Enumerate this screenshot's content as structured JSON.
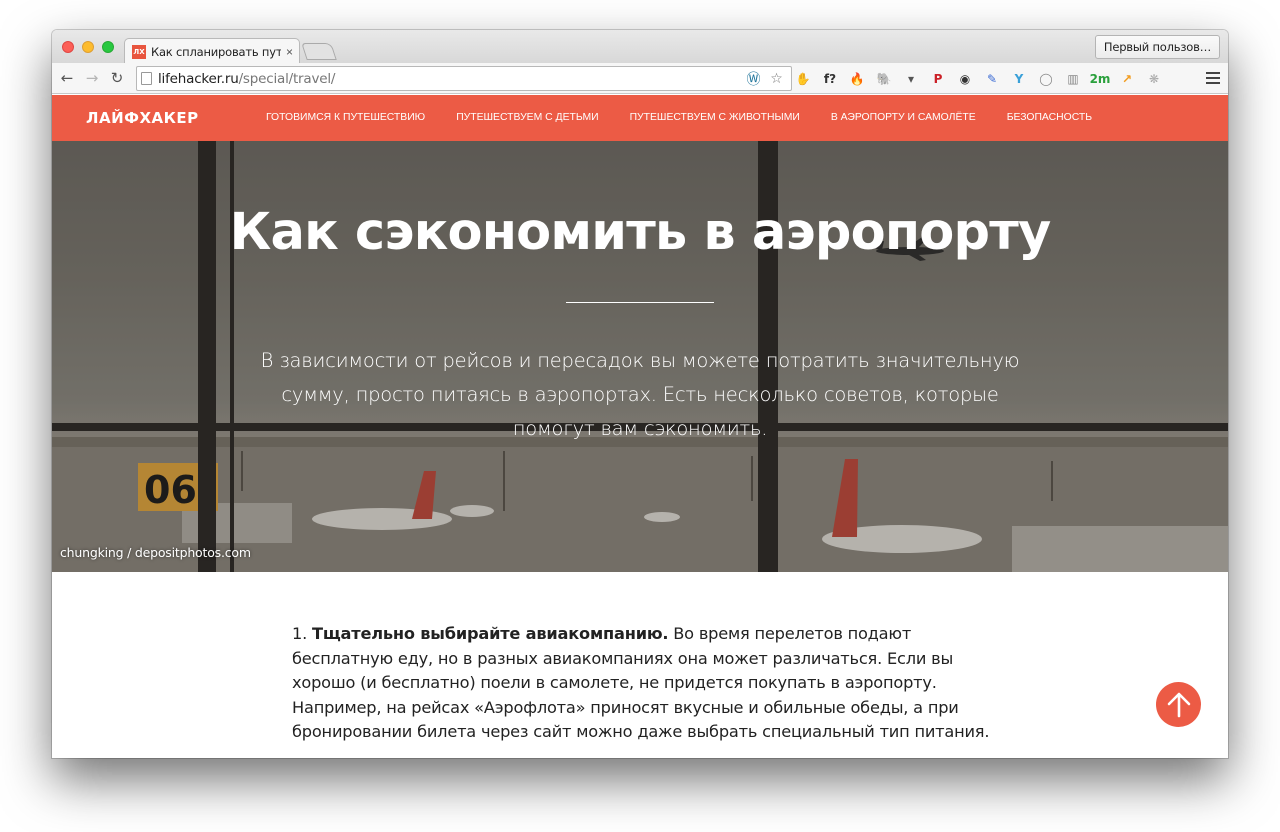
{
  "browser": {
    "tab": {
      "favicon_text": "ЛХ",
      "title": "Как спланировать путеше",
      "close": "×"
    },
    "profile_label": "Первый пользов…",
    "nav": {
      "back": "←",
      "forward": "→",
      "reload": "↻"
    },
    "url": {
      "host": "lifehacker.ru",
      "path": "/special/travel/"
    },
    "omnibox_icons": [
      "wordpress-icon",
      "star-icon"
    ],
    "extensions": [
      {
        "name": "adblock-icon",
        "glyph": "✋",
        "color": "#d22d2d"
      },
      {
        "name": "font-icon",
        "glyph": "f?",
        "color": "#ffffff"
      },
      {
        "name": "fire-icon",
        "glyph": "🔥",
        "color": "#ffffff"
      },
      {
        "name": "evernote-icon",
        "glyph": "🐘",
        "color": "#ffffff"
      },
      {
        "name": "pocket-icon",
        "glyph": "▾",
        "color": "#555555"
      },
      {
        "name": "pinterest-icon",
        "glyph": "P",
        "color": "#cb2027"
      },
      {
        "name": "camera-icon",
        "glyph": "◉",
        "color": "#333333"
      },
      {
        "name": "eyedropper-icon",
        "glyph": "✎",
        "color": "#3a6ad4"
      },
      {
        "name": "y-icon",
        "glyph": "Y",
        "color": "#3aa0d8"
      },
      {
        "name": "circle-icon",
        "glyph": "◯",
        "color": "#888888"
      },
      {
        "name": "reader-icon",
        "glyph": "▥",
        "color": "#888888"
      },
      {
        "name": "timer-icon",
        "glyph": "2m",
        "color": "#2aa03c"
      },
      {
        "name": "chart-icon",
        "glyph": "↗",
        "color": "#f29b1c"
      },
      {
        "name": "paw-icon",
        "glyph": "❋",
        "color": "#aaaaaa"
      }
    ]
  },
  "site": {
    "logo": "ЛАЙФХАКЕР",
    "nav": [
      "ГОТОВИМСЯ К ПУТЕШЕСТВИЮ",
      "ПУТЕШЕСТВУЕМ С ДЕТЬМИ",
      "ПУТЕШЕСТВУЕМ С ЖИВОТНЫМИ",
      "В АЭРОПОРТУ И САМОЛЁТЕ",
      "БЕЗОПАСНОСТЬ"
    ],
    "accent_color": "#ec5b45"
  },
  "hero": {
    "title": "Как сэкономить в аэропорту",
    "subtitle": "В зависимости от рейсов и пересадок вы можете потратить значительную сумму, просто питаясь в аэропортах. Есть несколько советов, которые помогут вам сэкономить.",
    "gate_sign": "06",
    "photo_credit": "chungking / depositphotos.com"
  },
  "article": {
    "number": "1.",
    "heading": "Тщательно выбирайте авиакомпанию.",
    "body": " Во время перелетов подают бесплатную еду, но в разных авиакомпаниях она может различаться. Если вы хорошо (и бесплатно) поели в самолете, не придется покупать в аэропорту. Например, на рейсах «Аэрофлота» приносят вкусные и обильные обеды, а при бронировании билета через сайт можно даже выбрать специальный тип питания."
  }
}
